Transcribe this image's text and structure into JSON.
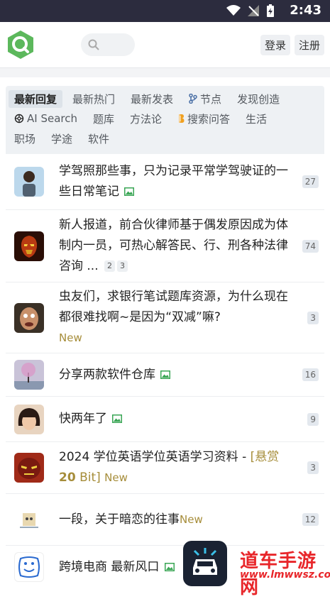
{
  "status": {
    "time": "2:43"
  },
  "header": {
    "login": "登录",
    "register": "注册"
  },
  "nav": [
    {
      "label": "最新回复",
      "active": true
    },
    {
      "label": "最新热门"
    },
    {
      "label": "最新发表"
    },
    {
      "label": "节点",
      "icon": "branch-icon"
    },
    {
      "label": "发现创造"
    },
    {
      "label": "AI Search",
      "icon": "openai-icon"
    },
    {
      "label": "题库"
    },
    {
      "label": "方法论"
    },
    {
      "label": "搜索问答",
      "icon": "bitcoin-icon"
    },
    {
      "label": "生活"
    },
    {
      "label": "职场"
    },
    {
      "label": "学途"
    },
    {
      "label": "软件"
    }
  ],
  "topics": [
    {
      "title": "学驾照那些事，只为记录平常学驾驶证的一些日常笔记",
      "count": "27"
    },
    {
      "title": "新人报道，前合伙律师基于偶发原因成为体制内一员，可热心解答民、行、刑各种法律咨询 ...",
      "pages": [
        "2",
        "3"
      ],
      "count": "74"
    },
    {
      "title": "虫友们，求银行笔试题库资源，为什么现在都很难找啊~是因为“双减”嘛?",
      "new": "New",
      "count": "3"
    },
    {
      "title": "分享两款软件仓库",
      "count": "16"
    },
    {
      "title": "快两年了",
      "count": "9"
    },
    {
      "title": "2024 学位英语学位英语学习资料 - ",
      "bounty_pre": "[悬赏 ",
      "bounty_num": "20",
      "bounty_post": " Bit]",
      "new": "New",
      "count": "3"
    },
    {
      "title": "一段，关于暗恋的往事",
      "new": "New",
      "count": "12"
    },
    {
      "title": "跨境电商 最新风口"
    }
  ],
  "watermark": {
    "line1": "道车手游网",
    "line2": "www.lmwwsz.com"
  },
  "colors": {
    "accent_green": "#4caf50",
    "new_gold": "#a68d3a",
    "statusbar": "#2c2c3e"
  }
}
